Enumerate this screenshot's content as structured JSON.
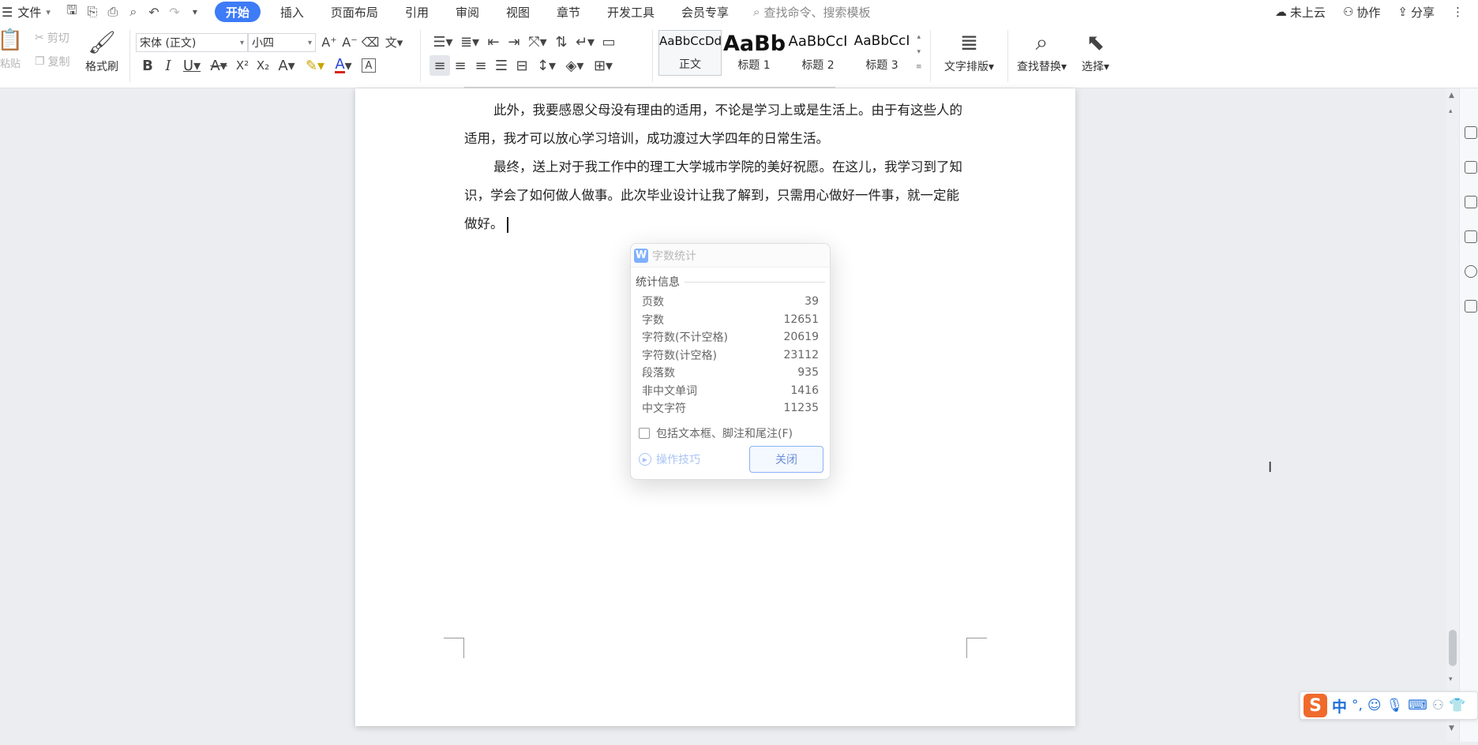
{
  "menubar": {
    "file_label": "文件",
    "tabs": [
      "开始",
      "插入",
      "页面布局",
      "引用",
      "审阅",
      "视图",
      "章节",
      "开发工具",
      "会员专享"
    ],
    "active_tab": "开始",
    "search_placeholder": "查找命令、搜索模板",
    "right": {
      "cloud": "未上云",
      "collab": "协作",
      "share": "分享"
    }
  },
  "ribbon": {
    "paste": "粘贴",
    "cut": "剪切",
    "copy": "复制",
    "format_painter": "格式刷",
    "font_name": "宋体 (正文)",
    "font_size": "小四",
    "styles": [
      {
        "preview": "AaBbCcDd",
        "name": "正文"
      },
      {
        "preview": "AaBb",
        "name": "标题 1"
      },
      {
        "preview": "AaBbCcI",
        "name": "标题 2"
      },
      {
        "preview": "AaBbCcI",
        "name": "标题 3"
      }
    ],
    "text_layout": "文字排版",
    "find_replace": "查找替换",
    "select": "选择"
  },
  "document": {
    "para1": "此外，我要感恩父母没有理由的适用，不论是学习上或是生活上。由于有这些人的适用，我才可以放心学习培训，成功渡过大学四年的日常生活。",
    "para2": "最终，送上对于我工作中的理工大学城市学院的美好祝愿。在这儿，我学习到了知识，学会了如何做人做事。此次毕业设计让我了解到，只需用心做好一件事，就一定能做好。"
  },
  "dialog": {
    "title": "字数统计",
    "section": "统计信息",
    "stats": [
      {
        "label": "页数",
        "value": "39"
      },
      {
        "label": "字数",
        "value": "12651"
      },
      {
        "label": "字符数(不计空格)",
        "value": "20619"
      },
      {
        "label": "字符数(计空格)",
        "value": "23112"
      },
      {
        "label": "段落数",
        "value": "935"
      },
      {
        "label": "非中文单词",
        "value": "1416"
      },
      {
        "label": "中文字符",
        "value": "11235"
      }
    ],
    "checkbox_label": "包括文本框、脚注和尾注(F)",
    "tips": "操作技巧",
    "close": "关闭"
  },
  "ime": {
    "logo": "S",
    "mode": "中",
    "punct": "°,"
  }
}
